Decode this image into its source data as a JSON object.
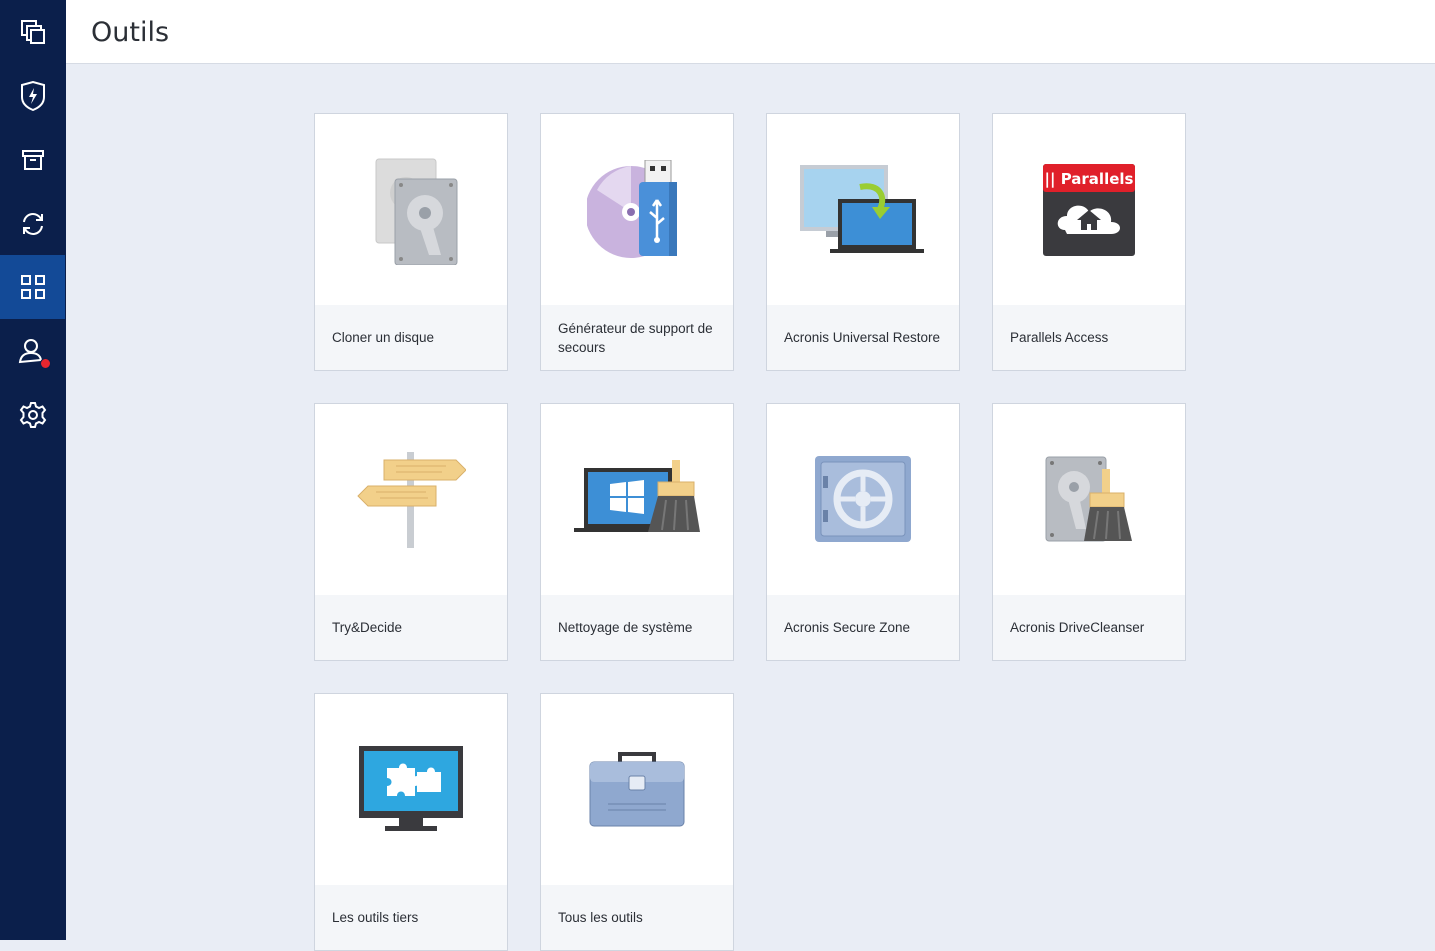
{
  "header": {
    "title": "Outils"
  },
  "sidebar": {
    "items": [
      {
        "icon": "copy-icon",
        "id": "backup"
      },
      {
        "icon": "shield-bolt-icon",
        "id": "protection"
      },
      {
        "icon": "archive-icon",
        "id": "archive"
      },
      {
        "icon": "sync-icon",
        "id": "sync"
      },
      {
        "icon": "grid-icon",
        "id": "tools",
        "active": true
      },
      {
        "icon": "account-icon",
        "id": "account",
        "badge": true
      },
      {
        "icon": "gear-icon",
        "id": "settings"
      }
    ]
  },
  "tools": [
    {
      "label": "Cloner un disque",
      "icon": "disk-clone-icon"
    },
    {
      "label": "Générateur de support de secours",
      "icon": "rescue-media-icon"
    },
    {
      "label": "Acronis Universal Restore",
      "icon": "universal-restore-icon"
    },
    {
      "label": "Parallels Access",
      "icon": "parallels-icon",
      "logo_text": "|| Parallels"
    },
    {
      "label": "Try&Decide",
      "icon": "signpost-icon"
    },
    {
      "label": "Nettoyage de système",
      "icon": "system-clean-icon"
    },
    {
      "label": "Acronis Secure Zone",
      "icon": "safe-icon"
    },
    {
      "label": "Acronis DriveCleanser",
      "icon": "drive-cleanser-icon"
    },
    {
      "label": "Les outils tiers",
      "icon": "puzzle-monitor-icon"
    },
    {
      "label": "Tous les outils",
      "icon": "toolbox-icon"
    }
  ],
  "colors": {
    "sidebar": "#0b1f4b",
    "sidebar_active": "#134a97",
    "background": "#e9edf5",
    "badge": "#e8262f"
  }
}
